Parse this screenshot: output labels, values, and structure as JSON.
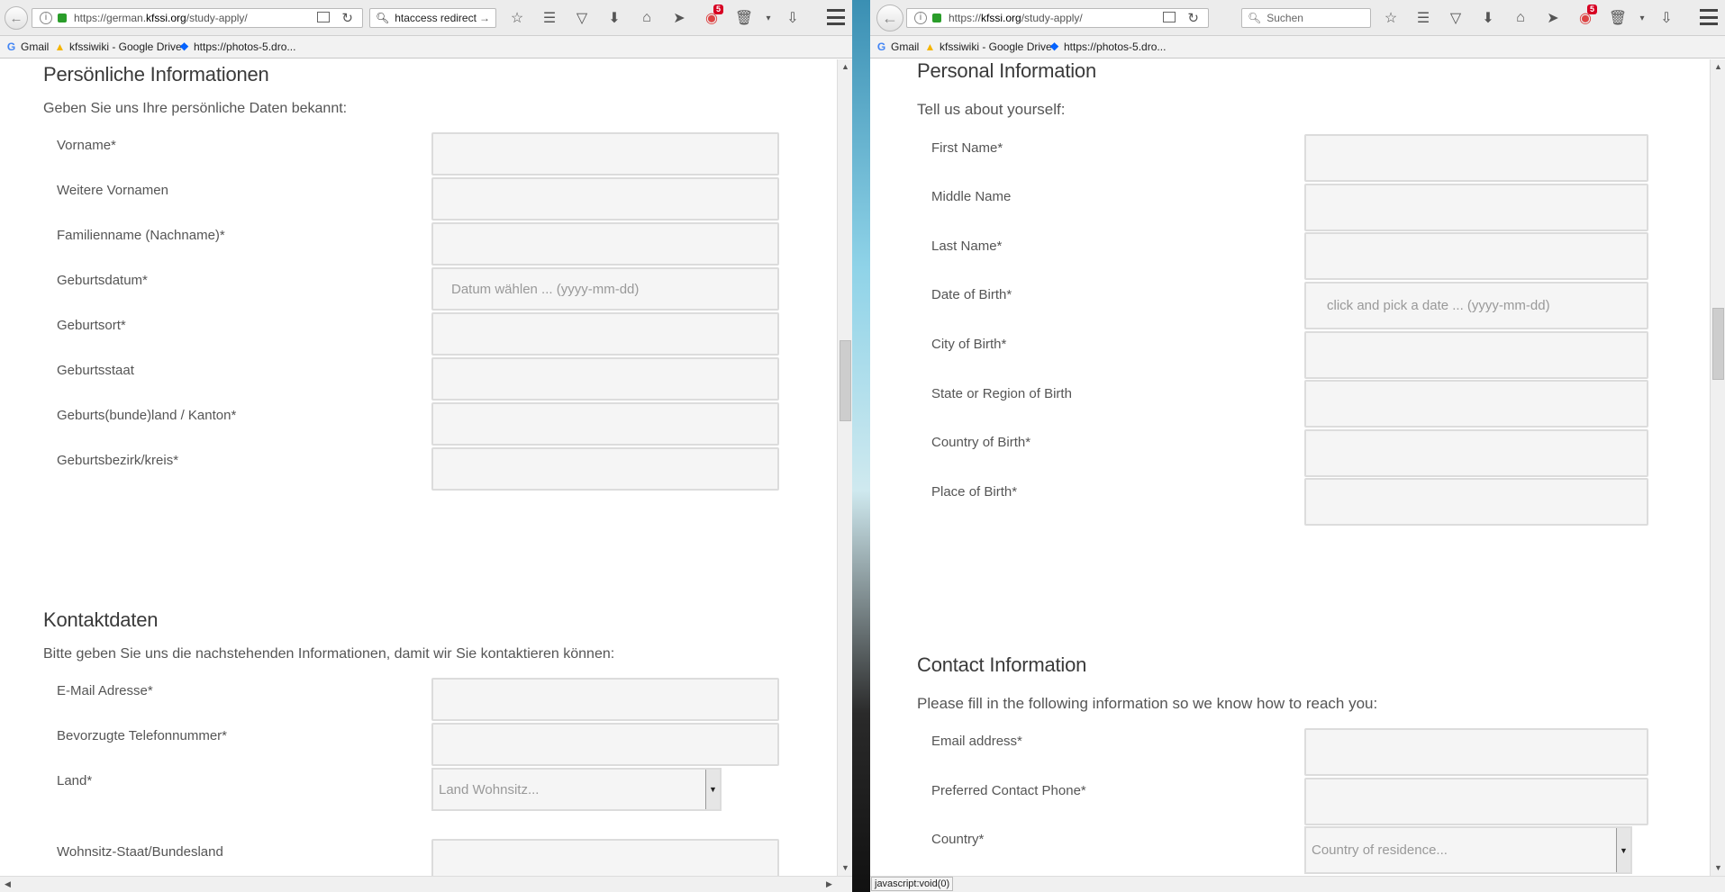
{
  "left": {
    "url_host": "https://german.",
    "url_domain": "kfssi.org",
    "url_path": "/study-apply/",
    "search_value": "htaccess redirect",
    "badge_count": "5",
    "bookmarks": [
      "Gmail",
      "kfssiwiki - Google Drive",
      "https://photos-5.dro..."
    ],
    "personal": {
      "title": "Persönliche Informationen",
      "intro": "Geben Sie uns Ihre persönliche Daten bekannt:",
      "fields": [
        {
          "label": "Vorname*",
          "placeholder": ""
        },
        {
          "label": "Weitere Vornamen",
          "placeholder": ""
        },
        {
          "label": "Familienname (Nachname)*",
          "placeholder": ""
        },
        {
          "label": "Geburtsdatum*",
          "placeholder": "Datum wählen ... (yyyy-mm-dd)"
        },
        {
          "label": "Geburtsort*",
          "placeholder": ""
        },
        {
          "label": "Geburtsstaat",
          "placeholder": ""
        },
        {
          "label": "Geburts(bunde)land / Kanton*",
          "placeholder": ""
        },
        {
          "label": "Geburtsbezirk/kreis*",
          "placeholder": ""
        }
      ]
    },
    "contact": {
      "title": "Kontaktdaten",
      "intro": "Bitte geben Sie uns die nachstehenden Informationen, damit wir Sie kontaktieren können:",
      "email_label": "E-Mail Adresse*",
      "phone_label": "Bevorzugte Telefonnummer*",
      "country_label": "Land*",
      "country_placeholder": "Land Wohnsitz...",
      "state_label": "Wohnsitz-Staat/Bundesland"
    }
  },
  "right": {
    "url_host": "https://",
    "url_domain": "kfssi.org",
    "url_path": "/study-apply/",
    "search_placeholder": "Suchen",
    "badge_count": "5",
    "bookmarks": [
      "Gmail",
      "kfssiwiki - Google Drive",
      "https://photos-5.dro..."
    ],
    "personal": {
      "title": "Personal Information",
      "intro": "Tell us about yourself:",
      "fields": [
        {
          "label": "First Name*",
          "placeholder": ""
        },
        {
          "label": "Middle Name",
          "placeholder": ""
        },
        {
          "label": "Last Name*",
          "placeholder": ""
        },
        {
          "label": "Date of Birth*",
          "placeholder": "click and pick a date ... (yyyy-mm-dd)"
        },
        {
          "label": "City of Birth*",
          "placeholder": ""
        },
        {
          "label": "State or Region of Birth",
          "placeholder": ""
        },
        {
          "label": "Country of Birth*",
          "placeholder": ""
        },
        {
          "label": "Place of Birth*",
          "placeholder": ""
        }
      ]
    },
    "contact": {
      "title": "Contact Information",
      "intro": "Please fill in the following information so we know how to reach you:",
      "email_label": "Email address*",
      "phone_label": "Preferred Contact Phone*",
      "country_label": "Country*",
      "country_placeholder": "Country of residence..."
    },
    "status_text": "javascript:void(0)"
  }
}
